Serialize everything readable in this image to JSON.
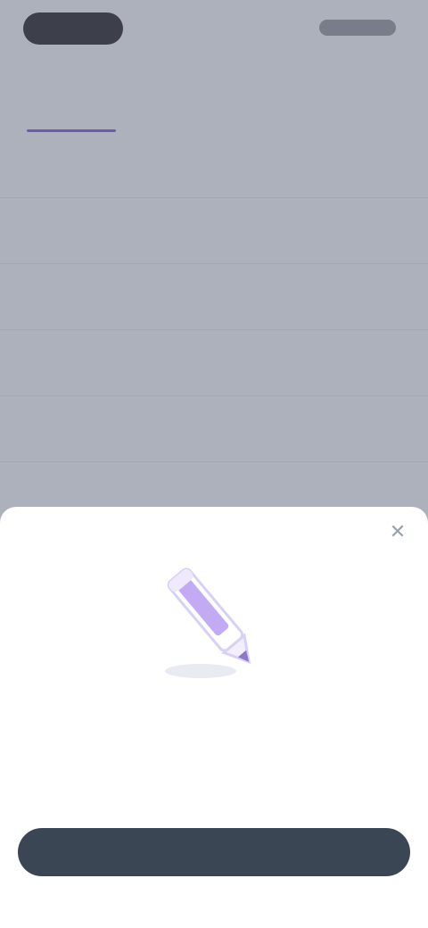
{
  "colors": {
    "accent": "#7a52e6",
    "primary_button": "#3b4654",
    "scrim": "#606778"
  },
  "background_app": {
    "title": "",
    "tabs": [
      {
        "label": "",
        "active": true
      },
      {
        "label": "",
        "active": false
      },
      {
        "label": "",
        "active": false
      }
    ],
    "list_items": [
      "",
      "",
      "",
      "",
      "",
      ""
    ]
  },
  "sheet": {
    "close_icon": "close-icon",
    "illustration_icon": "pencil-icon",
    "title": "",
    "description": "",
    "button_label": ""
  }
}
